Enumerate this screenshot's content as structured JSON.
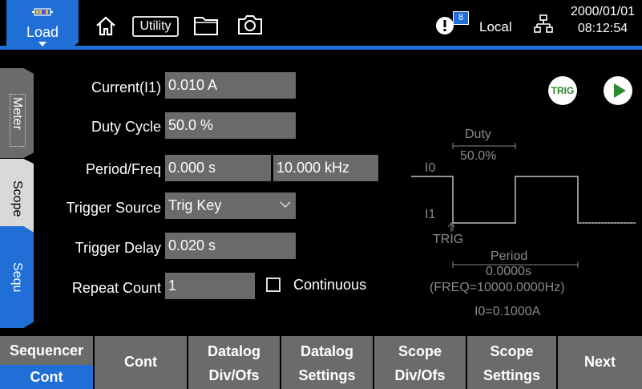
{
  "topbar": {
    "load_tab": "Load",
    "utility_label": "Utility",
    "alert_count": "8",
    "local_label": "Local",
    "date": "2000/01/01",
    "time": "08:12:54",
    "accent_color": "#1f6fd6"
  },
  "side_tabs": [
    "Meter",
    "Scope",
    "Sequ"
  ],
  "form": {
    "current": {
      "label": "Current(I1)",
      "value": "0.010 A"
    },
    "duty_cycle": {
      "label": "Duty Cycle",
      "value": "50.0 %"
    },
    "period_freq": {
      "label": "Period/Freq",
      "period": "0.000 s",
      "freq": "10.000 kHz"
    },
    "trigger_source": {
      "label": "Trigger Source",
      "value": "Trig Key"
    },
    "trigger_delay": {
      "label": "Trigger Delay",
      "value": "0.020 s"
    },
    "repeat_count": {
      "label": "Repeat Count",
      "value": "1"
    },
    "continuous_label": "Continuous",
    "continuous_checked": false
  },
  "buttons": {
    "trig": "TRIG",
    "trig_color": "#2e8b2e"
  },
  "diagram": {
    "duty_label": "Duty",
    "duty_value": "50.0%",
    "i0_label": "I0",
    "i1_label": "I1",
    "trig_label": "TRIG",
    "period_label": "Period",
    "period_value": "0.0000s",
    "freq_text": "(FREQ=10000.0000Hz)",
    "i0_value": "I0=0.1000A"
  },
  "softkeys": {
    "sequencer": {
      "top": "Sequencer",
      "bottom": "Cont"
    },
    "cont": "Cont",
    "datalog_divofs": {
      "line1": "Datalog",
      "line2": "Div/Ofs"
    },
    "datalog_settings": {
      "line1": "Datalog",
      "line2": "Settings"
    },
    "scope_divofs": {
      "line1": "Scope",
      "line2": "Div/Ofs"
    },
    "scope_settings": {
      "line1": "Scope",
      "line2": "Settings"
    },
    "next": "Next"
  }
}
